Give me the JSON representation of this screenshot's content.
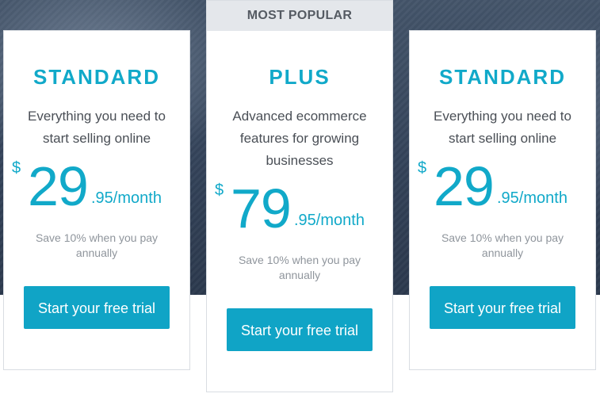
{
  "plans": [
    {
      "badge": "",
      "name": "STANDARD",
      "description": "Everything you need to start selling online",
      "currency": "$",
      "amount": "29",
      "cents": ".95/month",
      "save_note": "Save 10% when you pay annually",
      "cta": "Start your free trial"
    },
    {
      "badge": "MOST POPULAR",
      "name": "PLUS",
      "description": "Advanced ecommerce features for growing businesses",
      "currency": "$",
      "amount": "79",
      "cents": ".95/month",
      "save_note": "Save 10% when you pay annually",
      "cta": "Start your free trial"
    },
    {
      "badge": "",
      "name": "STANDARD",
      "description": "Everything you need to start selling online",
      "currency": "$",
      "amount": "29",
      "cents": ".95/month",
      "save_note": "Save 10% when you pay annually",
      "cta": "Start your free trial"
    }
  ],
  "colors": {
    "accent": "#11a9c9",
    "button": "#10a4c6",
    "badge_bg": "#e4e7eb",
    "hero_bg": "#34435a"
  }
}
